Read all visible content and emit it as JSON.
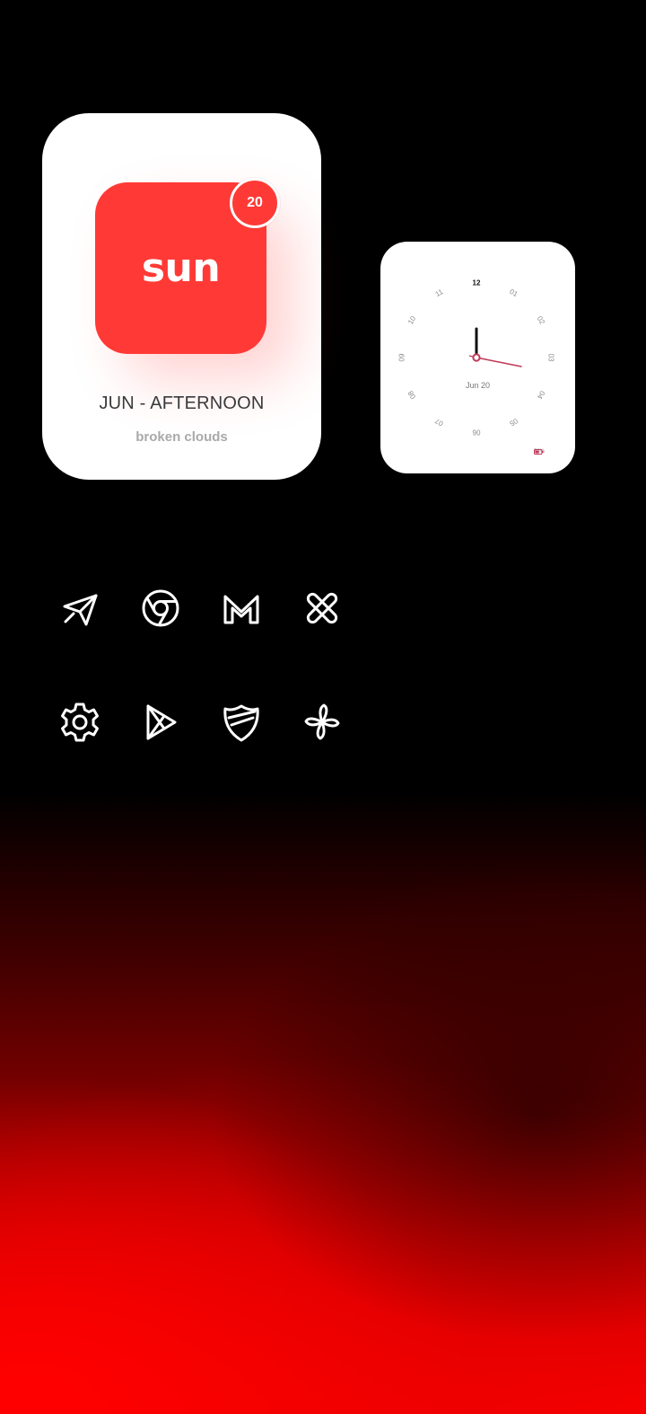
{
  "day_widget": {
    "day": "sun",
    "date_badge": "20",
    "period": "JUN - AFTERNOON",
    "condition": "broken clouds",
    "accent_color": "#ff3a36"
  },
  "clock_widget": {
    "date": "Jun 20",
    "battery": "53%",
    "time": {
      "hour": 12,
      "minute": 16
    },
    "dial_labels": [
      "12",
      "01",
      "02",
      "03",
      "04",
      "05",
      "06",
      "07",
      "08",
      "09",
      "10",
      "11"
    ],
    "hand_accent_color": "#c0395a"
  },
  "apps": [
    {
      "name": "telegram",
      "icon": "paper-plane-icon"
    },
    {
      "name": "chrome",
      "icon": "chrome-icon"
    },
    {
      "name": "gmail",
      "icon": "gmail-icon"
    },
    {
      "name": "tools",
      "icon": "wrench-cross-icon"
    },
    {
      "name": "settings",
      "icon": "gear-icon"
    },
    {
      "name": "play-store",
      "icon": "play-store-icon"
    },
    {
      "name": "security",
      "icon": "shield-icon"
    },
    {
      "name": "photos",
      "icon": "pinwheel-icon"
    }
  ]
}
